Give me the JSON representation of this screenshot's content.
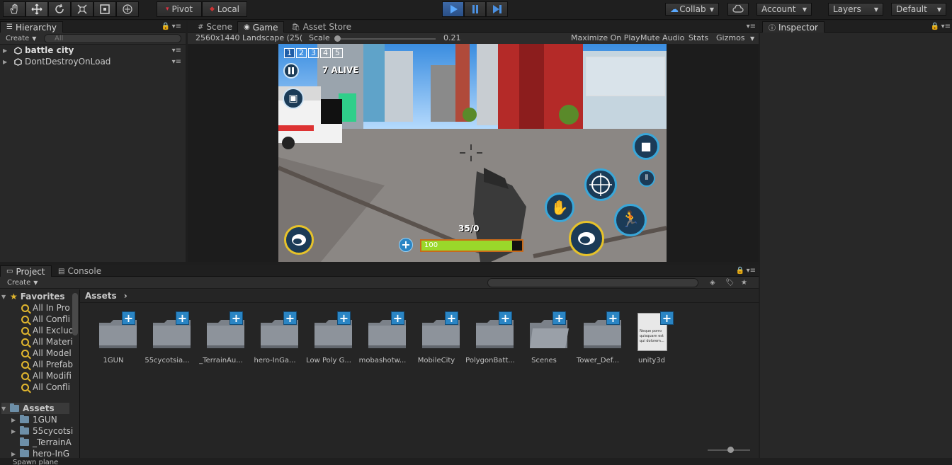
{
  "toolbar": {
    "pivot_label": "Pivot",
    "local_label": "Local",
    "collab_label": "Collab",
    "account_label": "Account",
    "layers_label": "Layers",
    "layout_label": "Default"
  },
  "hierarchy": {
    "tab_label": "Hierarchy",
    "create_label": "Create",
    "search_placeholder": "All",
    "items": [
      {
        "label": "battle city"
      },
      {
        "label": "DontDestroyOnLoad"
      }
    ]
  },
  "scene_tabs": [
    {
      "label": "Scene"
    },
    {
      "label": "Game"
    },
    {
      "label": "Asset Store"
    }
  ],
  "game_toolbar": {
    "resolution": "2560x1440 Landscape (25(",
    "scale_label": "Scale",
    "scale_value": "0.21",
    "maximize": "Maximize On Play",
    "mute": "Mute Audio",
    "stats": "Stats",
    "gizmos": "Gizmos"
  },
  "game_hud": {
    "weapon_slots": [
      "1",
      "2",
      "3",
      "4",
      "5"
    ],
    "alive_text": "7 ALIVE",
    "ammo": "35/0",
    "health": "100",
    "health_fraction": 0.9
  },
  "inspector": {
    "tab_label": "Inspector"
  },
  "project": {
    "tab_project": "Project",
    "tab_console": "Console",
    "create_label": "Create",
    "breadcrumb": "Assets",
    "favorites_label": "Favorites",
    "favorites": [
      {
        "label": "All In Pro"
      },
      {
        "label": "All Confli"
      },
      {
        "label": "All Exclud"
      },
      {
        "label": "All Materi"
      },
      {
        "label": "All Model"
      },
      {
        "label": "All Prefab"
      },
      {
        "label": "All Modifi"
      },
      {
        "label": "All Confli"
      }
    ],
    "assets_label": "Assets",
    "tree_assets": [
      {
        "label": "1GUN"
      },
      {
        "label": "55cycotsi"
      },
      {
        "label": "_TerrainA"
      },
      {
        "label": "hero-InG"
      }
    ],
    "grid_assets": [
      {
        "label": "1GUN"
      },
      {
        "label": "55cycotsia..."
      },
      {
        "label": "_TerrainAu..."
      },
      {
        "label": "hero-InGa..."
      },
      {
        "label": "Low Poly G..."
      },
      {
        "label": "mobashotw..."
      },
      {
        "label": "MobileCity"
      },
      {
        "label": "PolygonBatt..."
      },
      {
        "label": "Scenes"
      },
      {
        "label": "Tower_Def..."
      },
      {
        "label": "unity3d"
      }
    ],
    "doc_preview_text": "Neque porro quisquam est qui dolorem..."
  },
  "status": {
    "text": "Spawn plane"
  }
}
